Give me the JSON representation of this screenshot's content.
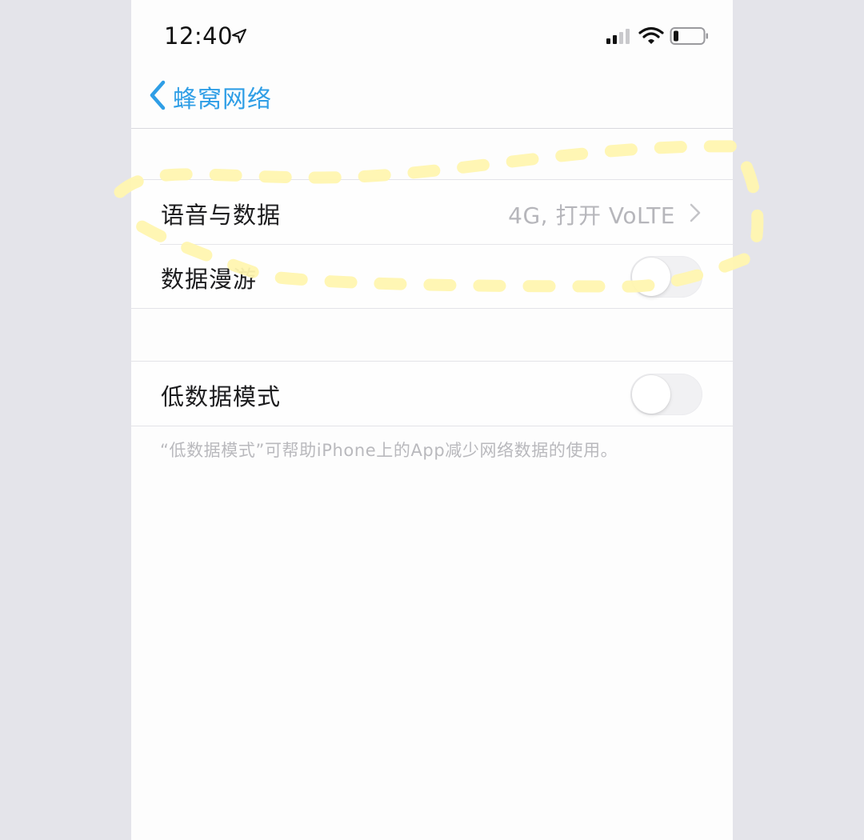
{
  "status_bar": {
    "time": "12:40",
    "icons": [
      "location-arrow-icon",
      "cellular-signal-icon",
      "wifi-icon",
      "battery-icon"
    ]
  },
  "nav": {
    "back_label": "蜂窝网络",
    "back_icon": "chevron-left-icon",
    "accent_color": "#2f9ee6"
  },
  "sections": [
    {
      "rows": [
        {
          "label": "语音与数据",
          "value": "4G, 打开 VoLTE",
          "type": "disclosure"
        },
        {
          "label": "数据漫游",
          "type": "toggle",
          "on": false
        }
      ]
    },
    {
      "rows": [
        {
          "label": "低数据模式",
          "type": "toggle",
          "on": false
        }
      ],
      "footer": "“低数据模式”可帮助iPhone上的App减少网络数据的使用。"
    }
  ],
  "annotation": {
    "shape": "dashed-loop-highlight",
    "color": "#fff6b0"
  }
}
